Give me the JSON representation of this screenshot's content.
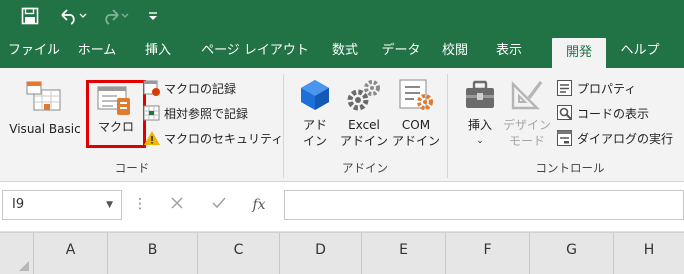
{
  "quick_access": {
    "save_icon": "save-icon",
    "undo_icon": "undo-icon",
    "redo_icon": "redo-icon",
    "customize_icon": "customize-quick-access-icon"
  },
  "tabs": [
    {
      "label": "ファイル"
    },
    {
      "label": "ホーム"
    },
    {
      "label": "挿入"
    },
    {
      "label": "ページ レイアウト"
    },
    {
      "label": "数式"
    },
    {
      "label": "データ"
    },
    {
      "label": "校閲"
    },
    {
      "label": "表示"
    },
    {
      "label": "開発",
      "active": true
    },
    {
      "label": "ヘルプ"
    }
  ],
  "ribbon": {
    "code_group": {
      "label": "コード",
      "visual_basic": "Visual Basic",
      "macro": "マクロ",
      "record_macro": "マクロの記録",
      "relative_ref": "相対参照で記録",
      "macro_security": "マクロのセキュリティ"
    },
    "addin_group": {
      "label": "アドイン",
      "addin_line1": "アド",
      "addin_line2": "イン",
      "excel_line1": "Excel",
      "excel_line2": "アドイン",
      "com_line1": "COM",
      "com_line2": "アドイン"
    },
    "control_group": {
      "label": "コントロール",
      "insert": "挿入",
      "design_line1": "デザイン",
      "design_line2": "モード",
      "properties": "プロパティ",
      "view_code": "コードの表示",
      "run_dialog": "ダイアログの実行"
    }
  },
  "formula_bar": {
    "name_box": "I9",
    "cancel_icon": "cancel-icon",
    "enter_icon": "enter-icon",
    "fx": "fx"
  },
  "columns": [
    "A",
    "B",
    "C",
    "D",
    "E",
    "F",
    "G",
    "H"
  ],
  "colors": {
    "accent": "#217346",
    "highlight_border": "#e00000"
  }
}
